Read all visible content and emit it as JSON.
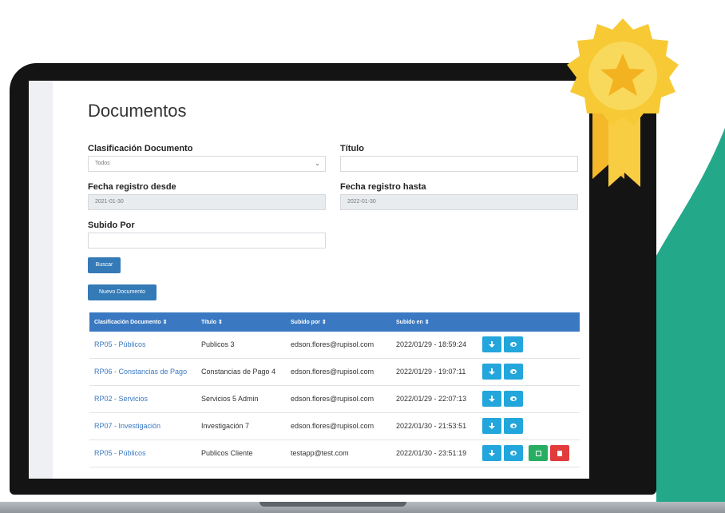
{
  "page": {
    "title": "Documentos"
  },
  "form": {
    "clasificacion_label": "Clasificación Documento",
    "clasificacion_value": "Todos",
    "titulo_label": "Título",
    "titulo_value": "",
    "fecha_desde_label": "Fecha registro desde",
    "fecha_desde_value": "2021-01-30",
    "fecha_hasta_label": "Fecha registro hasta",
    "fecha_hasta_value": "2022-01-30",
    "subido_por_label": "Subido Por",
    "subido_por_value": ""
  },
  "buttons": {
    "buscar": "Buscar",
    "nuevo_documento": "Nuevo Documento"
  },
  "table": {
    "headers": [
      "Clasificación Documento ⇕",
      "Título ⇕",
      "Subido por ⇕",
      "Subido en ⇕"
    ],
    "rows": [
      {
        "clasificacion": "RP05 - Públicos",
        "titulo": "Publicos 3",
        "subido_por": "edson.flores@rupisol.com",
        "subido_en": "2022/01/29 - 18:59:24"
      },
      {
        "clasificacion": "RP06 - Constancias de Pago",
        "titulo": "Constancias de Pago 4",
        "subido_por": "edson.flores@rupisol.com",
        "subido_en": "2022/01/29 - 19:07:11"
      },
      {
        "clasificacion": "RP02 - Servicios",
        "titulo": "Servicios 5 Admin",
        "subido_por": "edson.flores@rupisol.com",
        "subido_en": "2022/01/29 - 22:07:13"
      },
      {
        "clasificacion": "RP07 - Investigación",
        "titulo": "Investigación 7",
        "subido_por": "edson.flores@rupisol.com",
        "subido_en": "2022/01/30 - 21:53:51"
      },
      {
        "clasificacion": "RP05 - Públicos",
        "titulo": "Publicos Cliente",
        "subido_por": "testapp@test.com",
        "subido_en": "2022/01/30 - 23:51:19"
      }
    ]
  },
  "icons": {
    "download": "download-icon",
    "view": "eye-icon",
    "edit": "edit-icon",
    "delete": "trash-icon",
    "dropdown": "chevron-down-icon",
    "badge": "award-star-badge"
  },
  "colors": {
    "primary": "#337ab7",
    "table_header": "#3a79c2",
    "action_blue": "#23a6db",
    "action_green": "#27ae60",
    "action_red": "#e23b3b",
    "teal_background": "#23a98a",
    "badge_gold": "#f7c934"
  }
}
